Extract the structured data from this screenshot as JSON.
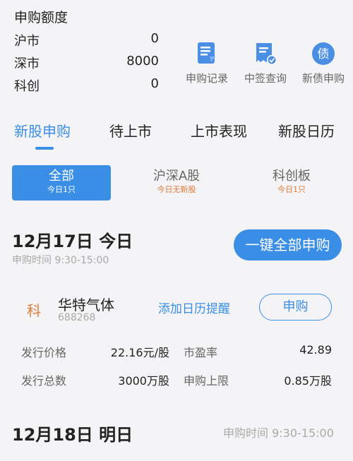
{
  "quota": {
    "title": "申购额度",
    "rows": [
      {
        "label": "沪市",
        "value": "0"
      },
      {
        "label": "深市",
        "value": "8000"
      },
      {
        "label": "科创",
        "value": "0"
      }
    ]
  },
  "quick_actions": [
    {
      "label": "申购记录",
      "icon": "document-icon"
    },
    {
      "label": "中签查询",
      "icon": "receipt-check-icon"
    },
    {
      "label": "新债申购",
      "icon": "bond-icon",
      "glyph": "债"
    }
  ],
  "tabs": [
    "新股申购",
    "待上市",
    "上市表现",
    "新股日历"
  ],
  "segments": [
    {
      "title": "全部",
      "sub": "今日1只"
    },
    {
      "title": "沪深A股",
      "sub": "今日无新股"
    },
    {
      "title": "科创板",
      "sub": "今日1只"
    }
  ],
  "today": {
    "title": "12月17日 今日",
    "time": "申购时间 9:30-15:00",
    "one_click_label": "一键全部申购"
  },
  "stock": {
    "badge": "科",
    "name": "华特气体",
    "code": "688268",
    "remind_label": "添加日历提醒",
    "subscribe_label": "申购",
    "fields": [
      {
        "label": "发行价格",
        "value": "22.16元/股"
      },
      {
        "label": "市盈率",
        "value": "42.89"
      },
      {
        "label": "发行总数",
        "value": "3000万股"
      },
      {
        "label": "申购上限",
        "value": "0.85万股"
      }
    ]
  },
  "tomorrow": {
    "title": "12月18日 明日",
    "time": "申购时间 9:30-15:00"
  },
  "colors": {
    "accent": "#3a8ee6",
    "orange": "#e07b3a"
  }
}
